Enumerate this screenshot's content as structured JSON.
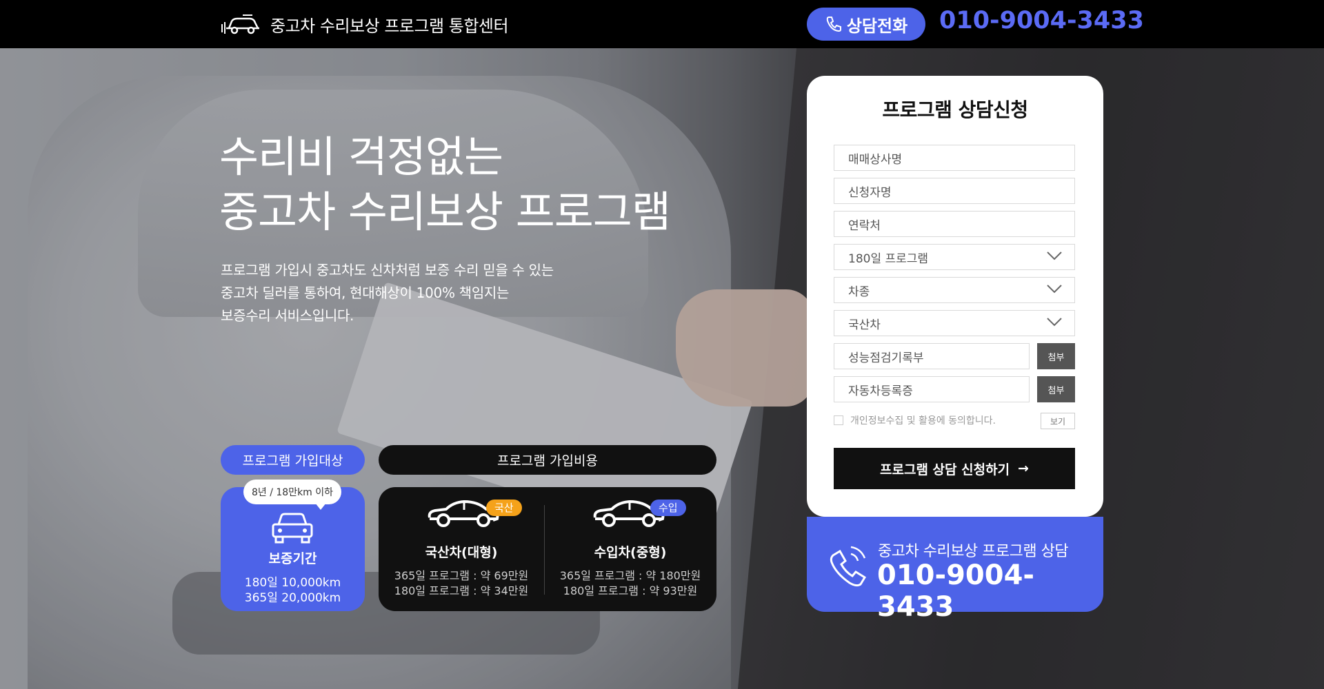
{
  "header": {
    "logo_text": "중고차 수리보상 프로그램 통합센터",
    "call_button_label": "상담전화",
    "phone": "010-9004-3433"
  },
  "hero": {
    "title_line1": "수리비 걱정없는",
    "title_line2": "중고차 수리보상 프로그램",
    "desc_line1": "프로그램 가입시 중고차도 신차처럼 보증 수리 믿을 수 있는",
    "desc_line2": "중고차 딜러를 통하여, 현대해상이 100% 책임지는",
    "desc_line3": "보증수리 서비스입니다."
  },
  "eligibility": {
    "pill_label": "프로그램 가입대상",
    "bubble": "8년 / 18만km 이하",
    "title": "보증기간",
    "line1": "180일 10,000km",
    "line2": "365일 20,000km"
  },
  "cost": {
    "pill_label": "프로그램 가입비용",
    "domestic": {
      "badge": "국산",
      "title": "국산차(대형)",
      "line1": "365일 프로그램 : 약 69만원",
      "line2": "180일 프로그램 : 약 34만원"
    },
    "imported": {
      "badge": "수입",
      "title": "수입차(중형)",
      "line1": "365일 프로그램 : 약 180만원",
      "line2": "180일 프로그램 : 약 93만원"
    }
  },
  "form": {
    "title": "프로그램 상담신청",
    "dealer_placeholder": "매매상사명",
    "applicant_placeholder": "신청자명",
    "contact_placeholder": "연락처",
    "program_select": "180일 프로그램",
    "cartype_select": "차종",
    "origin_select": "국산차",
    "inspection_placeholder": "성능점검기록부",
    "registration_placeholder": "자동차등록증",
    "attach_label": "첨부",
    "agree_text": "개인정보수집 및 활용에 동의합니다.",
    "view_label": "보기",
    "submit_label": "프로그램 상담 신청하기",
    "submit_arrow": "→"
  },
  "contact_box": {
    "label": "중고차 수리보상 프로그램 상담",
    "phone": "010-9004-3433"
  },
  "colors": {
    "accent": "#4d63e8",
    "badge_domestic": "#f5a21a",
    "topbar": "#000000"
  }
}
